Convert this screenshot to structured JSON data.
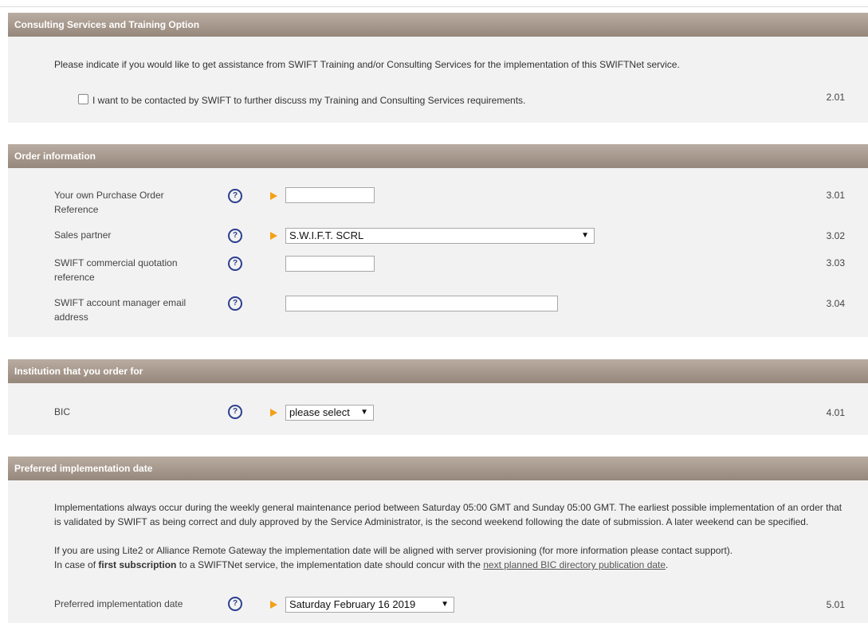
{
  "sections": {
    "consulting": {
      "title": "Consulting Services and Training Option",
      "intro": "Please indicate if you would like to get assistance from SWIFT Training and/or Consulting Services for the implementation of this SWIFTNet service.",
      "checkbox_label": "I want to be contacted by SWIFT to further discuss my Training and Consulting Services requirements.",
      "checkbox_checked": false,
      "num": "2.01"
    },
    "order": {
      "title": "Order information",
      "po_label": "Your own Purchase Order Reference",
      "po_value": "",
      "po_num": "3.01",
      "sales_label": "Sales partner",
      "sales_value": "S.W.I.F.T. SCRL",
      "sales_num": "3.02",
      "quote_label": "SWIFT commercial quotation reference",
      "quote_value": "",
      "quote_num": "3.03",
      "manager_label": "SWIFT account manager email address",
      "manager_value": "",
      "manager_num": "3.04"
    },
    "institution": {
      "title": "Institution that you order for",
      "bic_label": "BIC",
      "bic_value": "please select",
      "bic_num": "4.01"
    },
    "implementation": {
      "title": "Preferred implementation date",
      "para1": "Implementations always occur during the weekly general maintenance period between Saturday 05:00 GMT and Sunday 05:00 GMT. The earliest possible implementation of an order that is validated by SWIFT as being correct and duly approved by the Service Administrator, is the second weekend following the date of submission. A later weekend can be specified.",
      "para2": "If you are using Lite2 or Alliance Remote Gateway the implementation date will be aligned with server provisioning (for more information please contact support).",
      "para3_prefix": "In case of ",
      "para3_bold": "first subscription",
      "para3_middle": " to a SWIFTNet service, the implementation date should concur with the ",
      "para3_link": "next planned BIC directory publication date",
      "para3_suffix": ".",
      "date_label": "Preferred implementation date",
      "date_value": "Saturday February 16 2019",
      "date_num": "5.01"
    }
  },
  "icons": {
    "help": "help-question-icon",
    "required": "required-arrow-icon",
    "dropdown": "dropdown-caret-icon"
  },
  "colors": {
    "header_bg": "#a89a8e",
    "section_bg": "#f2f2f2",
    "required_arrow": "#f4a019",
    "help_icon": "#2c3e8f"
  }
}
